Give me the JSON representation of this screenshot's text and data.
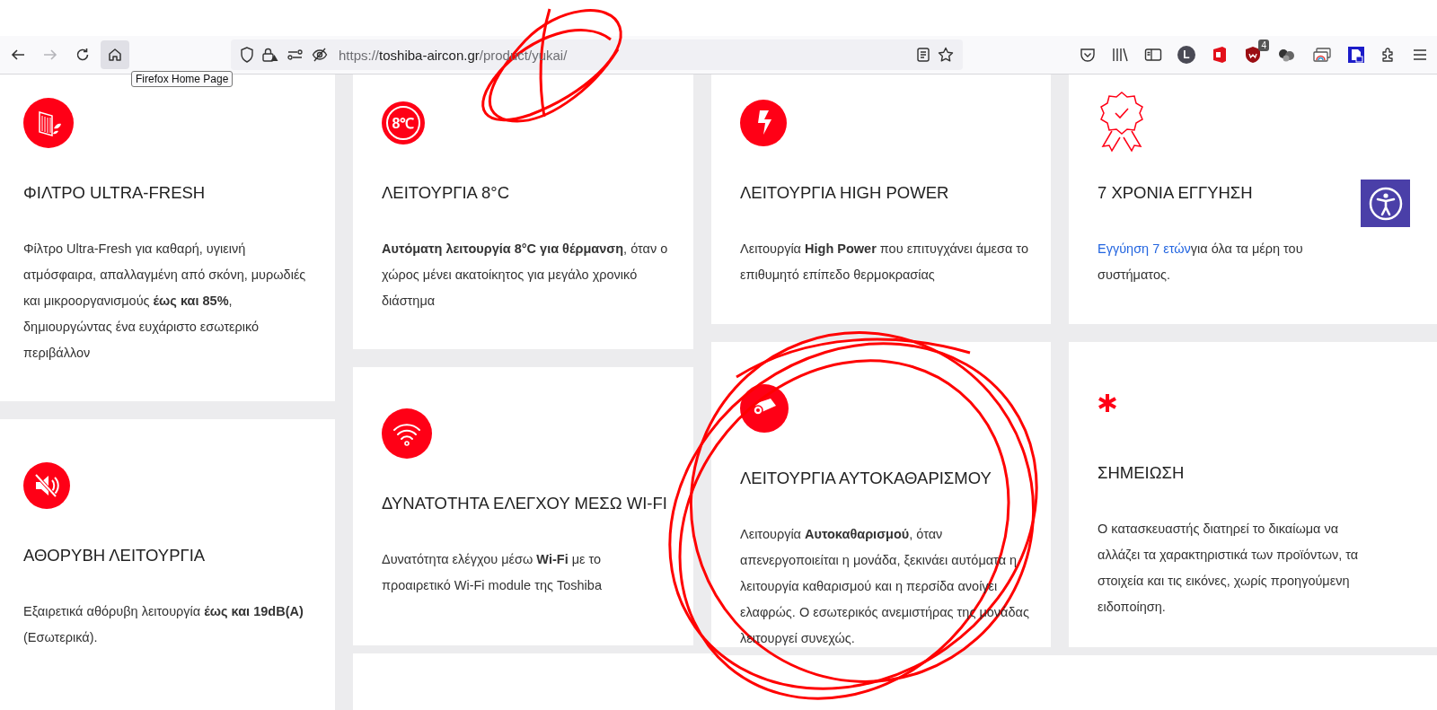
{
  "browser": {
    "nav": [
      {
        "kind": "back",
        "disabled": false,
        "highlighted": false
      },
      {
        "kind": "forward",
        "disabled": true,
        "highlighted": false
      },
      {
        "kind": "reload",
        "disabled": false,
        "highlighted": false
      },
      {
        "kind": "home",
        "disabled": false,
        "highlighted": true
      }
    ],
    "tooltip": "Firefox Home Page",
    "url": {
      "scheme": "https://",
      "host": "toshiba-aircon.gr",
      "path": "/product/yukai/"
    },
    "extensions": [
      {
        "kind": "pocket"
      },
      {
        "kind": "library"
      },
      {
        "kind": "sidebar"
      },
      {
        "kind": "account",
        "letter": "L"
      },
      {
        "kind": "office"
      },
      {
        "kind": "shield",
        "badge": "4"
      },
      {
        "kind": "balls"
      },
      {
        "kind": "screens"
      },
      {
        "kind": "lock"
      },
      {
        "kind": "puzzle"
      },
      {
        "kind": "menu"
      }
    ]
  },
  "columns": [
    {
      "cards": [
        {
          "kind": "filter",
          "title": "ΦΙΛΤΡΟ ULTRA-FRESH",
          "body": "Φίλτρο Ultra-Fresh για καθαρή, υγιεινή ατμόσφαιρα, απαλλαγμένη από σκόνη, μυρωδιές και μικροοργανισμούς **έως και 85%**, δημιουργώντας ένα ευχάριστο εσωτερικό περιβάλλον"
        },
        {
          "kind": "mute",
          "title": "ΑΘΟΡΥΒΗ ΛΕΙΤΟΥΡΓΙΑ",
          "body": "Εξαιρετικά αθόρυβη λειτουργία **έως και 19dB(A)** (Εσωτερικά)."
        }
      ]
    },
    {
      "cards": [
        {
          "kind": "temperature",
          "icon_label": "8℃",
          "title": "ΛΕΙΤΟΥΡΓΙΑ 8°C",
          "body": "**Αυτόματη λειτουργία 8°C για θέρμανση**, όταν ο χώρος μένει ακατοίκητος για μεγάλο χρονικό διάστημα"
        },
        {
          "kind": "wifi",
          "title": "ΔΥΝΑΤΟΤΗΤΑ ΕΛΕΓΧΟΥ ΜΕΣΩ WI-FI",
          "body": "Δυνατότητα ελέγχου μέσω **Wi-Fi** με το προαιρετικό Wi-Fi module της Toshiba"
        }
      ]
    },
    {
      "cards": [
        {
          "kind": "bolt",
          "title": "ΛΕΙΤΟΥΡΓΙΑ HIGH POWER",
          "body": "Λειτουργία **High Power** που επιτυγχάνει άμεσα το επιθυμητό επίπεδο θερμοκρασίας"
        },
        {
          "kind": "clean",
          "title": "ΛΕΙΤΟΥΡΓΙΑ ΑΥΤΟΚΑΘΑΡΙΣΜΟΥ",
          "body": "Λειτουργία **Αυτοκαθαρισμού**, όταν απενεργοποιείται η μονάδα, ξεκινάει αυτόματα η λειτουργία καθαρισμού και η περσίδα ανοίγει ελαφρώς. Ο εσωτερικός ανεμιστήρας της μονάδας λειτουργεί συνεχώς."
        }
      ]
    },
    {
      "cards": [
        {
          "kind": "award",
          "title": "7 ΧΡΟΝΙΑ ΕΓΓΥΗΣΗ",
          "link": "Εγγύηση 7 ετών",
          "body": "για όλα τα μέρη του συστήματος."
        },
        {
          "kind": "asterisk",
          "title": "ΣΗΜΕΙΩΣΗ",
          "body": "Ο κατασκευαστής διατηρεί το δικαίωμα να αλλάζει τα χαρακτηριστικά των προϊόντων, τα στοιχεία και τις εικόνες, χωρίς προηγούμενη ειδοποίηση."
        }
      ]
    }
  ],
  "accessibility_button": true
}
